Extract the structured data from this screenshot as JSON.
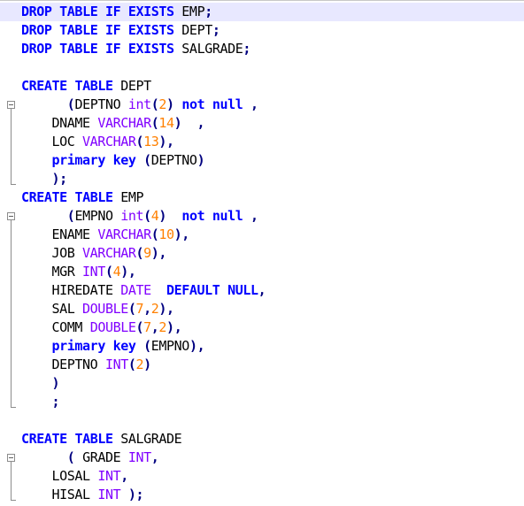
{
  "editor": {
    "lines": [
      {
        "current": true,
        "tokens": [
          {
            "t": "DROP",
            "c": "kw"
          },
          {
            "t": " ",
            "c": "id"
          },
          {
            "t": "TABLE",
            "c": "kw"
          },
          {
            "t": " ",
            "c": "id"
          },
          {
            "t": "IF",
            "c": "kw"
          },
          {
            "t": " ",
            "c": "id"
          },
          {
            "t": "EXISTS",
            "c": "kw"
          },
          {
            "t": " EMP",
            "c": "id"
          },
          {
            "t": ";",
            "c": "op"
          }
        ]
      },
      {
        "tokens": [
          {
            "t": "DROP",
            "c": "kw"
          },
          {
            "t": " ",
            "c": "id"
          },
          {
            "t": "TABLE",
            "c": "kw"
          },
          {
            "t": " ",
            "c": "id"
          },
          {
            "t": "IF",
            "c": "kw"
          },
          {
            "t": " ",
            "c": "id"
          },
          {
            "t": "EXISTS",
            "c": "kw"
          },
          {
            "t": " DEPT",
            "c": "id"
          },
          {
            "t": ";",
            "c": "op"
          }
        ]
      },
      {
        "tokens": [
          {
            "t": "DROP",
            "c": "kw"
          },
          {
            "t": " ",
            "c": "id"
          },
          {
            "t": "TABLE",
            "c": "kw"
          },
          {
            "t": " ",
            "c": "id"
          },
          {
            "t": "IF",
            "c": "kw"
          },
          {
            "t": " ",
            "c": "id"
          },
          {
            "t": "EXISTS",
            "c": "kw"
          },
          {
            "t": " SALGRADE",
            "c": "id"
          },
          {
            "t": ";",
            "c": "op"
          }
        ]
      },
      {
        "tokens": []
      },
      {
        "tokens": [
          {
            "t": "CREATE",
            "c": "kw"
          },
          {
            "t": " ",
            "c": "id"
          },
          {
            "t": "TABLE",
            "c": "kw"
          },
          {
            "t": " DEPT",
            "c": "id"
          }
        ]
      },
      {
        "fold": "start",
        "tokens": [
          {
            "t": "      ",
            "c": "id"
          },
          {
            "t": "(",
            "c": "op"
          },
          {
            "t": "DEPTNO ",
            "c": "id"
          },
          {
            "t": "int",
            "c": "ty"
          },
          {
            "t": "(",
            "c": "op"
          },
          {
            "t": "2",
            "c": "num"
          },
          {
            "t": ")",
            "c": "op"
          },
          {
            "t": " ",
            "c": "id"
          },
          {
            "t": "not",
            "c": "kw"
          },
          {
            "t": " ",
            "c": "id"
          },
          {
            "t": "null",
            "c": "kw"
          },
          {
            "t": " ",
            "c": "id"
          },
          {
            "t": ",",
            "c": "op"
          }
        ]
      },
      {
        "fold": "mid",
        "tokens": [
          {
            "t": "    DNAME ",
            "c": "id"
          },
          {
            "t": "VARCHAR",
            "c": "ty"
          },
          {
            "t": "(",
            "c": "op"
          },
          {
            "t": "14",
            "c": "num"
          },
          {
            "t": ")",
            "c": "op"
          },
          {
            "t": "  ",
            "c": "id"
          },
          {
            "t": ",",
            "c": "op"
          }
        ]
      },
      {
        "fold": "mid",
        "tokens": [
          {
            "t": "    LOC ",
            "c": "id"
          },
          {
            "t": "VARCHAR",
            "c": "ty"
          },
          {
            "t": "(",
            "c": "op"
          },
          {
            "t": "13",
            "c": "num"
          },
          {
            "t": ")",
            "c": "op"
          },
          {
            "t": ",",
            "c": "op"
          }
        ]
      },
      {
        "fold": "mid",
        "tokens": [
          {
            "t": "    ",
            "c": "id"
          },
          {
            "t": "primary",
            "c": "kw"
          },
          {
            "t": " ",
            "c": "id"
          },
          {
            "t": "key",
            "c": "kw"
          },
          {
            "t": " ",
            "c": "id"
          },
          {
            "t": "(",
            "c": "op"
          },
          {
            "t": "DEPTNO",
            "c": "id"
          },
          {
            "t": ")",
            "c": "op"
          }
        ]
      },
      {
        "fold": "end",
        "tokens": [
          {
            "t": "    ",
            "c": "id"
          },
          {
            "t": ")",
            "c": "op"
          },
          {
            "t": ";",
            "c": "op"
          }
        ]
      },
      {
        "tokens": [
          {
            "t": "CREATE",
            "c": "kw"
          },
          {
            "t": " ",
            "c": "id"
          },
          {
            "t": "TABLE",
            "c": "kw"
          },
          {
            "t": " EMP",
            "c": "id"
          }
        ]
      },
      {
        "fold": "start",
        "tokens": [
          {
            "t": "      ",
            "c": "id"
          },
          {
            "t": "(",
            "c": "op"
          },
          {
            "t": "EMPNO ",
            "c": "id"
          },
          {
            "t": "int",
            "c": "ty"
          },
          {
            "t": "(",
            "c": "op"
          },
          {
            "t": "4",
            "c": "num"
          },
          {
            "t": ")",
            "c": "op"
          },
          {
            "t": "  ",
            "c": "id"
          },
          {
            "t": "not",
            "c": "kw"
          },
          {
            "t": " ",
            "c": "id"
          },
          {
            "t": "null",
            "c": "kw"
          },
          {
            "t": " ",
            "c": "id"
          },
          {
            "t": ",",
            "c": "op"
          }
        ]
      },
      {
        "fold": "mid",
        "tokens": [
          {
            "t": "    ENAME ",
            "c": "id"
          },
          {
            "t": "VARCHAR",
            "c": "ty"
          },
          {
            "t": "(",
            "c": "op"
          },
          {
            "t": "10",
            "c": "num"
          },
          {
            "t": ")",
            "c": "op"
          },
          {
            "t": ",",
            "c": "op"
          }
        ]
      },
      {
        "fold": "mid",
        "tokens": [
          {
            "t": "    JOB ",
            "c": "id"
          },
          {
            "t": "VARCHAR",
            "c": "ty"
          },
          {
            "t": "(",
            "c": "op"
          },
          {
            "t": "9",
            "c": "num"
          },
          {
            "t": ")",
            "c": "op"
          },
          {
            "t": ",",
            "c": "op"
          }
        ]
      },
      {
        "fold": "mid",
        "tokens": [
          {
            "t": "    MGR ",
            "c": "id"
          },
          {
            "t": "INT",
            "c": "ty"
          },
          {
            "t": "(",
            "c": "op"
          },
          {
            "t": "4",
            "c": "num"
          },
          {
            "t": ")",
            "c": "op"
          },
          {
            "t": ",",
            "c": "op"
          }
        ]
      },
      {
        "fold": "mid",
        "tokens": [
          {
            "t": "    HIREDATE ",
            "c": "id"
          },
          {
            "t": "DATE",
            "c": "ty"
          },
          {
            "t": "  ",
            "c": "id"
          },
          {
            "t": "DEFAULT",
            "c": "kw"
          },
          {
            "t": " ",
            "c": "id"
          },
          {
            "t": "NULL",
            "c": "kw"
          },
          {
            "t": ",",
            "c": "op"
          }
        ]
      },
      {
        "fold": "mid",
        "tokens": [
          {
            "t": "    SAL ",
            "c": "id"
          },
          {
            "t": "DOUBLE",
            "c": "ty"
          },
          {
            "t": "(",
            "c": "op"
          },
          {
            "t": "7",
            "c": "num"
          },
          {
            "t": ",",
            "c": "op"
          },
          {
            "t": "2",
            "c": "num"
          },
          {
            "t": ")",
            "c": "op"
          },
          {
            "t": ",",
            "c": "op"
          }
        ]
      },
      {
        "fold": "mid",
        "tokens": [
          {
            "t": "    COMM ",
            "c": "id"
          },
          {
            "t": "DOUBLE",
            "c": "ty"
          },
          {
            "t": "(",
            "c": "op"
          },
          {
            "t": "7",
            "c": "num"
          },
          {
            "t": ",",
            "c": "op"
          },
          {
            "t": "2",
            "c": "num"
          },
          {
            "t": ")",
            "c": "op"
          },
          {
            "t": ",",
            "c": "op"
          }
        ]
      },
      {
        "fold": "mid",
        "tokens": [
          {
            "t": "    ",
            "c": "id"
          },
          {
            "t": "primary",
            "c": "kw"
          },
          {
            "t": " ",
            "c": "id"
          },
          {
            "t": "key",
            "c": "kw"
          },
          {
            "t": " ",
            "c": "id"
          },
          {
            "t": "(",
            "c": "op"
          },
          {
            "t": "EMPNO",
            "c": "id"
          },
          {
            "t": ")",
            "c": "op"
          },
          {
            "t": ",",
            "c": "op"
          }
        ]
      },
      {
        "fold": "mid",
        "tokens": [
          {
            "t": "    DEPTNO ",
            "c": "id"
          },
          {
            "t": "INT",
            "c": "ty"
          },
          {
            "t": "(",
            "c": "op"
          },
          {
            "t": "2",
            "c": "num"
          },
          {
            "t": ")",
            "c": "op"
          }
        ]
      },
      {
        "fold": "mid",
        "tokens": [
          {
            "t": "    ",
            "c": "id"
          },
          {
            "t": ")",
            "c": "op"
          }
        ]
      },
      {
        "fold": "end",
        "tokens": [
          {
            "t": "    ",
            "c": "id"
          },
          {
            "t": ";",
            "c": "op"
          }
        ]
      },
      {
        "tokens": []
      },
      {
        "tokens": [
          {
            "t": "CREATE",
            "c": "kw"
          },
          {
            "t": " ",
            "c": "id"
          },
          {
            "t": "TABLE",
            "c": "kw"
          },
          {
            "t": " SALGRADE",
            "c": "id"
          }
        ]
      },
      {
        "fold": "start",
        "tokens": [
          {
            "t": "      ",
            "c": "id"
          },
          {
            "t": "(",
            "c": "op"
          },
          {
            "t": " GRADE ",
            "c": "id"
          },
          {
            "t": "INT",
            "c": "ty"
          },
          {
            "t": ",",
            "c": "op"
          }
        ]
      },
      {
        "fold": "mid",
        "tokens": [
          {
            "t": "    LOSAL ",
            "c": "id"
          },
          {
            "t": "INT",
            "c": "ty"
          },
          {
            "t": ",",
            "c": "op"
          }
        ]
      },
      {
        "fold": "end",
        "tokens": [
          {
            "t": "    HISAL ",
            "c": "id"
          },
          {
            "t": "INT",
            "c": "ty"
          },
          {
            "t": " ",
            "c": "id"
          },
          {
            "t": ")",
            "c": "op"
          },
          {
            "t": ";",
            "c": "op"
          }
        ]
      }
    ]
  }
}
